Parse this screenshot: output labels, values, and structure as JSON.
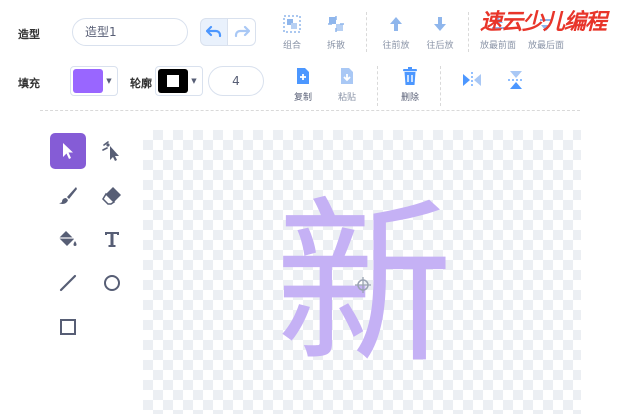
{
  "costume": {
    "label": "造型",
    "name": "造型1"
  },
  "toolbar": {
    "group": "组合",
    "ungroup": "拆散",
    "forward": "往前放",
    "backward": "往后放",
    "front": "放最前面",
    "back": "放最后面",
    "copy": "复制",
    "paste": "粘贴",
    "delete": "删除"
  },
  "fill": {
    "label": "填充",
    "color": "#9966ff"
  },
  "outline": {
    "label": "轮廓",
    "color": "#000000",
    "width": "4"
  },
  "canvas": {
    "glyph": "新",
    "glyph_color": "#c5b1f5"
  },
  "tools": [
    "select",
    "reshape",
    "brush",
    "eraser",
    "fill",
    "text",
    "line",
    "circle",
    "rectangle"
  ],
  "watermark": {
    "text": "速云少儿编程",
    "color": "#e8352a"
  },
  "accent": "#855cd6"
}
